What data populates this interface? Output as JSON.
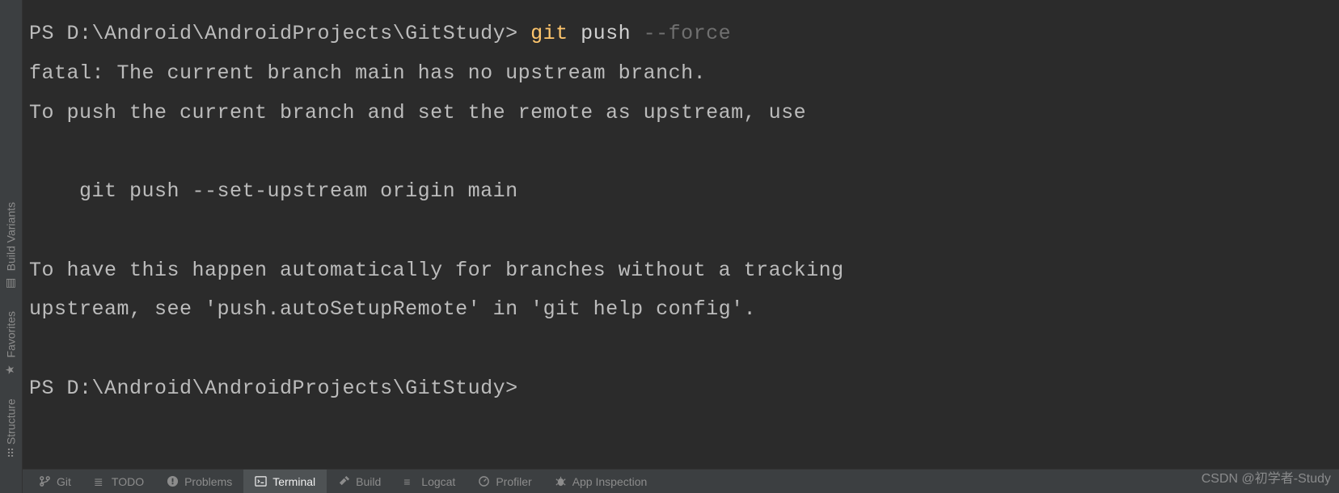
{
  "terminal": {
    "lines": {
      "l1_prompt": "PS D:\\Android\\AndroidProjects\\GitStudy> ",
      "l1_cmd_a": "git",
      "l1_cmd_b": " push ",
      "l1_cmd_c": "--force",
      "l2": "fatal: The current branch main has no upstream branch.",
      "l3": "To push the current branch and set the remote as upstream, use",
      "l4": "",
      "l5": "    git push --set-upstream origin main",
      "l6": "",
      "l7": "To have this happen automatically for branches without a tracking",
      "l8": "upstream, see 'push.autoSetupRemote' in 'git help config'.",
      "l9": "",
      "l10": "PS D:\\Android\\AndroidProjects\\GitStudy>"
    }
  },
  "side_tabs": {
    "build_variants": "Build Variants",
    "favorites": "Favorites",
    "structure": "Structure"
  },
  "bottom_tabs": {
    "git": "Git",
    "todo": "TODO",
    "problems": "Problems",
    "terminal": "Terminal",
    "build": "Build",
    "logcat": "Logcat",
    "profiler": "Profiler",
    "app_inspection": "App Inspection"
  },
  "watermark": "CSDN @初学者-Study"
}
